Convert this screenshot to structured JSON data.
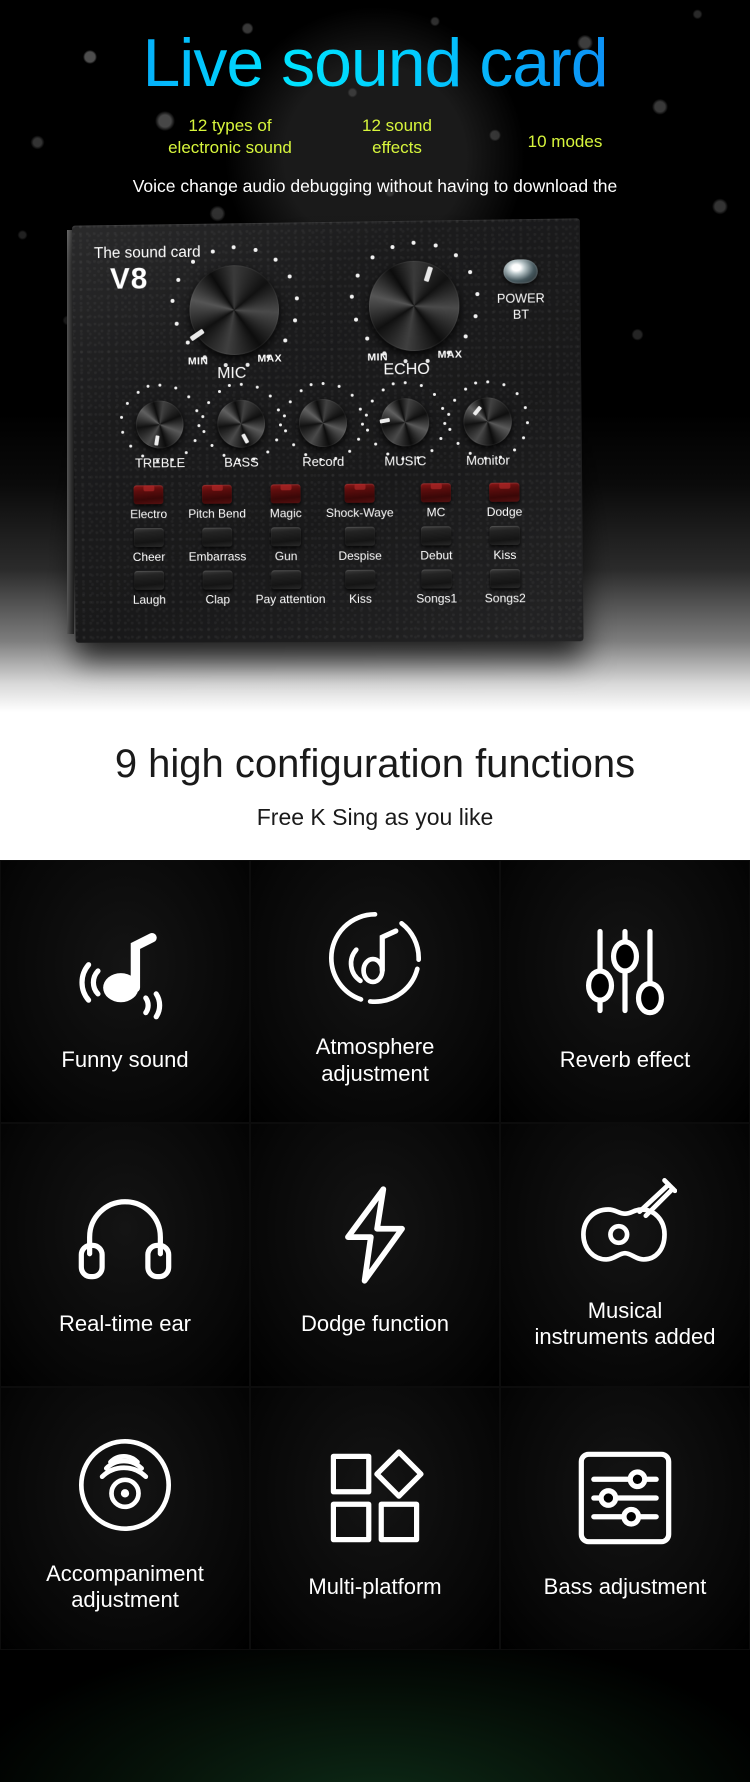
{
  "hero": {
    "title": "Live sound card",
    "features": [
      "12 types of\nelectronic sound",
      "12 sound\neffects",
      "10 modes"
    ],
    "feature1_line1": "12 types of",
    "feature1_line2": "electronic sound",
    "feature2_line1": "12 sound",
    "feature2_line2": "effects",
    "feature3": "10 modes",
    "tagline": "Voice change audio debugging without having to download the",
    "title_gradient_start": "#0a7cf5",
    "title_gradient_mid": "#00e3ff",
    "feature_color": "#d7f53c"
  },
  "device": {
    "brand": "The sound card",
    "model": "V8",
    "big_knobs": [
      {
        "label": "MIC",
        "min": "MIN",
        "max": "MAX"
      },
      {
        "label": "ECHO",
        "min": "MIN",
        "max": "MAX"
      }
    ],
    "power": {
      "line1": "POWER",
      "line2": "BT"
    },
    "small_knobs": [
      "TREBLE",
      "BASS",
      "Record",
      "MUSIC",
      "Monitor"
    ],
    "button_rows": [
      {
        "style": "red",
        "labels": [
          "Electro",
          "Pitch Bend",
          "Magic",
          "Shock-Waye",
          "MC",
          "Dodge"
        ]
      },
      {
        "style": "dark",
        "labels": [
          "Cheer",
          "Embarrass",
          "Gun",
          "Despise",
          "Debut",
          "Kiss"
        ]
      },
      {
        "style": "dark",
        "labels": [
          "Laugh",
          "Clap",
          "Pay attention",
          "Kiss",
          "Songs1",
          "Songs2"
        ]
      }
    ]
  },
  "white_section": {
    "heading": "9 high configuration functions",
    "subheading": "Free K  Sing as you like"
  },
  "feature_grid": {
    "items": [
      {
        "label": "Funny sound",
        "icon": "music-note-sound-icon"
      },
      {
        "label": "Atmosphere\nadjustment",
        "icon": "vinyl-note-icon",
        "line1": "Atmosphere",
        "line2": "adjustment"
      },
      {
        "label": "Reverb effect",
        "icon": "sliders-icon"
      },
      {
        "label": "Real-time ear",
        "icon": "headphones-icon"
      },
      {
        "label": "Dodge function",
        "icon": "lightning-bolt-icon"
      },
      {
        "label": "Musical\ninstruments added",
        "icon": "guitar-icon",
        "line1": "Musical",
        "line2": "instruments added"
      },
      {
        "label": "Accompaniment\nadjustment",
        "icon": "record-disc-icon",
        "line1": "Accompaniment",
        "line2": "adjustment"
      },
      {
        "label": "Multi-platform",
        "icon": "squares-diamond-icon"
      },
      {
        "label": "Bass adjustment",
        "icon": "equalizer-panel-icon"
      }
    ]
  }
}
